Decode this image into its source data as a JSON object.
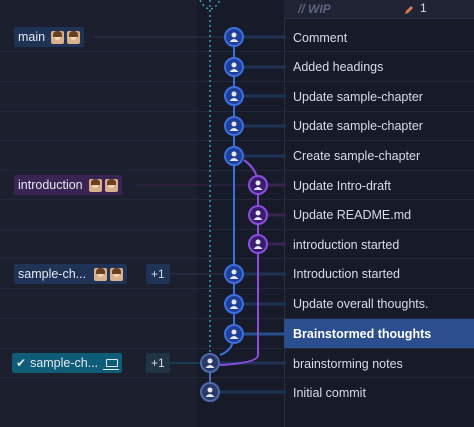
{
  "header": {
    "wip": "// WIP",
    "count": "1"
  },
  "branches": [
    {
      "name": "main",
      "style": "blue"
    },
    {
      "name": "introduction",
      "style": "purple"
    },
    {
      "name": "sample-ch...",
      "style": "blue",
      "extra": "+1"
    },
    {
      "name": "sample-ch...",
      "style": "active",
      "extra": "+1",
      "checked": true
    }
  ],
  "commits": [
    {
      "message": "Comment"
    },
    {
      "message": "Added headings"
    },
    {
      "message": "Update sample-chapter"
    },
    {
      "message": "Update sample-chapter"
    },
    {
      "message": "Create sample-chapter"
    },
    {
      "message": "Update Intro-draft"
    },
    {
      "message": "Update README.md"
    },
    {
      "message": "introduction started"
    },
    {
      "message": "Introduction started"
    },
    {
      "message": "Update overall thoughts."
    },
    {
      "message": "Brainstormed thoughts",
      "selected": true
    },
    {
      "message": "brainstorming notes"
    },
    {
      "message": "Initial commit"
    }
  ],
  "colors": {
    "blue_lane": "#3d6fe0",
    "purple_lane": "#8b4fe0",
    "selected": "#2b4f8e"
  },
  "icons": {
    "node": "avatar-node-icon",
    "pencil": "pencil-icon",
    "laptop": "laptop-icon",
    "check": "check-icon"
  }
}
